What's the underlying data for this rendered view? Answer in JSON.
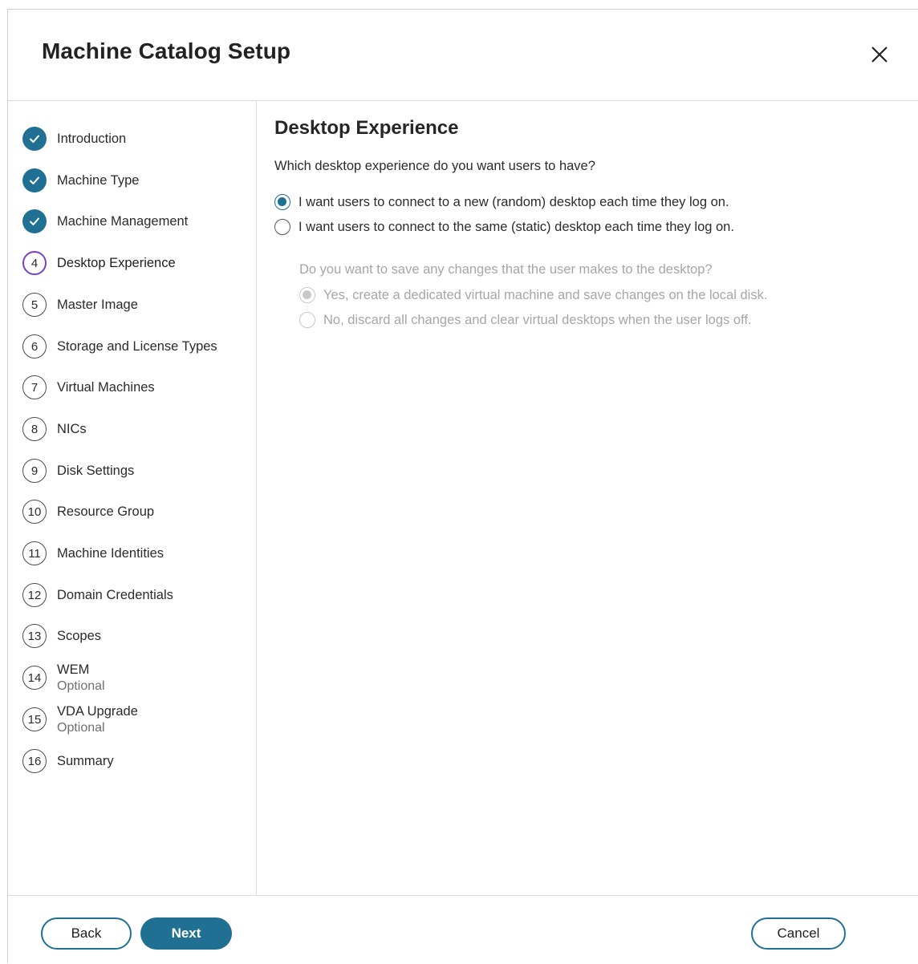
{
  "dialog": {
    "title": "Machine Catalog Setup"
  },
  "steps": [
    {
      "marker": "check",
      "label": "Introduction",
      "sub": "",
      "state": "done"
    },
    {
      "marker": "check",
      "label": "Machine Type",
      "sub": "",
      "state": "done"
    },
    {
      "marker": "check",
      "label": "Machine Management",
      "sub": "",
      "state": "done"
    },
    {
      "marker": "4",
      "label": "Desktop Experience",
      "sub": "",
      "state": "current"
    },
    {
      "marker": "5",
      "label": "Master Image",
      "sub": "",
      "state": "pending"
    },
    {
      "marker": "6",
      "label": "Storage and License Types",
      "sub": "",
      "state": "pending"
    },
    {
      "marker": "7",
      "label": "Virtual Machines",
      "sub": "",
      "state": "pending"
    },
    {
      "marker": "8",
      "label": "NICs",
      "sub": "",
      "state": "pending"
    },
    {
      "marker": "9",
      "label": "Disk Settings",
      "sub": "",
      "state": "pending"
    },
    {
      "marker": "10",
      "label": "Resource Group",
      "sub": "",
      "state": "pending"
    },
    {
      "marker": "11",
      "label": "Machine Identities",
      "sub": "",
      "state": "pending"
    },
    {
      "marker": "12",
      "label": "Domain Credentials",
      "sub": "",
      "state": "pending"
    },
    {
      "marker": "13",
      "label": "Scopes",
      "sub": "",
      "state": "pending"
    },
    {
      "marker": "14",
      "label": "WEM",
      "sub": "Optional",
      "state": "pending"
    },
    {
      "marker": "15",
      "label": "VDA Upgrade",
      "sub": "Optional",
      "state": "pending"
    },
    {
      "marker": "16",
      "label": "Summary",
      "sub": "",
      "state": "pending"
    }
  ],
  "main": {
    "section_title": "Desktop Experience",
    "question": "Which desktop experience do you want users to have?",
    "option_random": "I want users to connect to a new (random) desktop each time they log on.",
    "option_static": "I want users to connect to the same (static) desktop each time they log on.",
    "sub_question": "Do you want to save any changes that the user makes to the desktop?",
    "sub_option_yes": "Yes, create a dedicated virtual machine and save changes on the local disk.",
    "sub_option_no": "No, discard all changes and clear virtual desktops when the user logs off."
  },
  "footer": {
    "back_label": "Back",
    "next_label": "Next",
    "cancel_label": "Cancel"
  },
  "colors": {
    "accent": "#1f7093",
    "current_step_ring": "#7a3fc7",
    "disabled_text": "#a6a6a6"
  }
}
